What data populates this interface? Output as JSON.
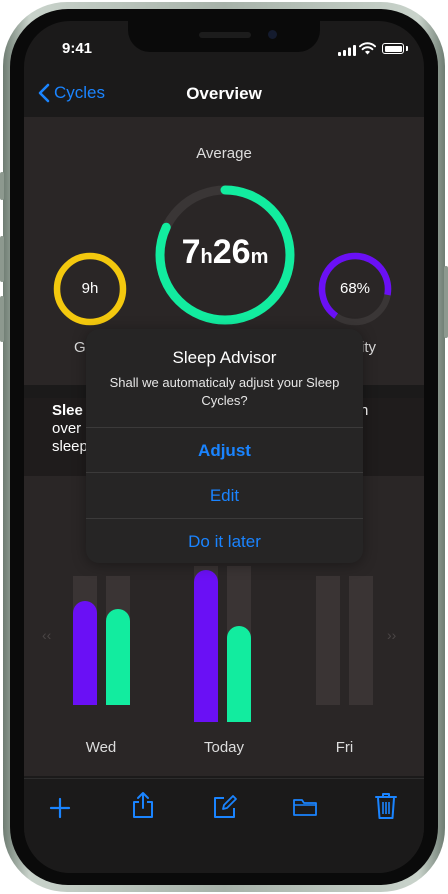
{
  "status": {
    "time": "9:41"
  },
  "nav": {
    "back_label": "Cycles",
    "title": "Overview"
  },
  "summary": {
    "average_label": "Average",
    "main_hours": "7",
    "main_h_unit": "h",
    "main_minutes": "26",
    "main_m_unit": "m",
    "left_ring_text": "9h",
    "left_label": "G",
    "right_ring_text": "68%",
    "right_label": "ity"
  },
  "description": {
    "bold": "Slee",
    "line1_end": "n",
    "line2": "over",
    "line3": "sleep"
  },
  "chart": {
    "days": [
      "Wed",
      "Today",
      "Fri"
    ],
    "prev_arrow": "‹‹",
    "next_arrow": "››"
  },
  "alert": {
    "title": "Sleep Advisor",
    "message": "Shall we automaticaly adjust your Sleep Cycles?",
    "buttons": [
      "Adjust",
      "Edit",
      "Do it later"
    ]
  },
  "colors": {
    "accent": "#1a84ff",
    "green": "#12ec9f",
    "yellow": "#f3c80e",
    "purple": "#6a10f5"
  },
  "toolbar_icons": [
    "plus-icon",
    "share-icon",
    "compose-icon",
    "folder-icon",
    "trash-icon"
  ]
}
